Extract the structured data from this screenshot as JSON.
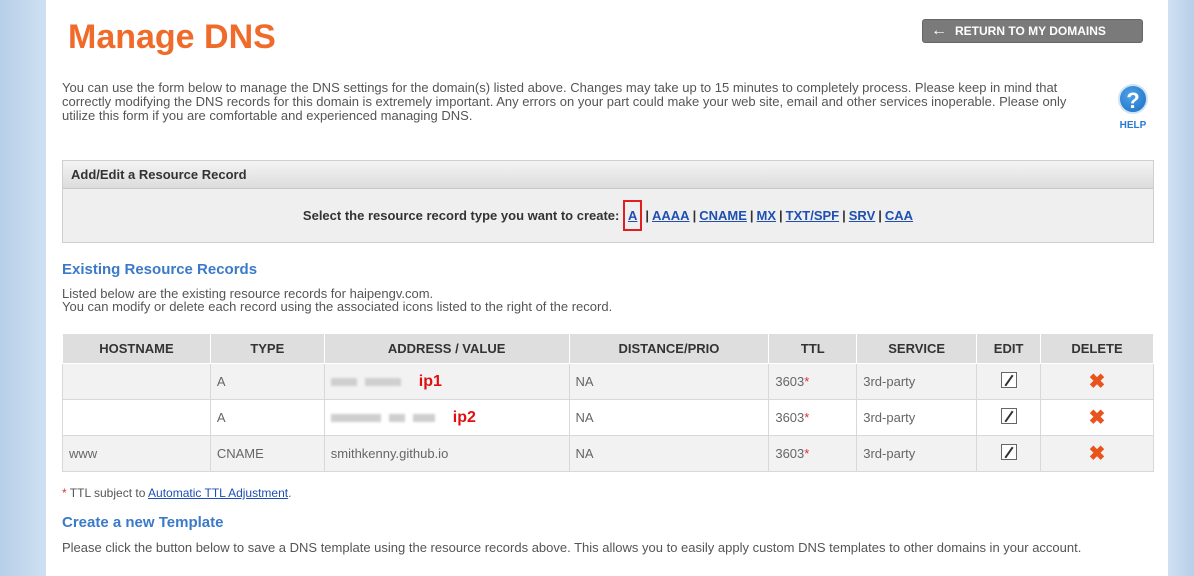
{
  "page": {
    "title": "Manage DNS",
    "return_label": "RETURN TO MY DOMAINS",
    "return_icon": "arrow-left-icon",
    "intro": "You can use the form below to manage the DNS settings for the domain(s) listed above. Changes may take up to 15 minutes to completely process. Please keep in mind that correctly modifying the DNS records for this domain is extremely important. Any errors on your part could make your web site, email and other services inoperable. Please only utilize this form if you are comfortable and experienced managing DNS.",
    "help_label": "HELP",
    "help_glyph": "?"
  },
  "add_record": {
    "header": "Add/Edit a Resource Record",
    "prompt": "Select the resource record type you want to create:",
    "types": [
      "A",
      "AAAA",
      "CNAME",
      "MX",
      "TXT/SPF",
      "SRV",
      "CAA"
    ],
    "highlight_color": "#e02020"
  },
  "existing": {
    "title": "Existing Resource Records",
    "desc_line1": "Listed below are the existing resource records for haipengv.com.",
    "desc_line2": "You can modify or delete each record using the associated icons listed to the right of the record.",
    "columns": [
      "HOSTNAME",
      "TYPE",
      "ADDRESS / VALUE",
      "DISTANCE/PRIO",
      "TTL",
      "SERVICE",
      "EDIT",
      "DELETE"
    ],
    "rows": [
      {
        "hostname": "",
        "type": "A",
        "address": "",
        "annotation": "ip1",
        "prio": "NA",
        "ttl": "3603",
        "service": "3rd-party"
      },
      {
        "hostname": "",
        "type": "A",
        "address": "",
        "annotation": "ip2",
        "prio": "NA",
        "ttl": "3603",
        "service": "3rd-party"
      },
      {
        "hostname": "www",
        "type": "CNAME",
        "address": "smithkenny.github.io",
        "annotation": "",
        "prio": "NA",
        "ttl": "3603",
        "service": "3rd-party"
      }
    ],
    "ttl_star": "*",
    "edit_icon": "edit-pencil-icon",
    "delete_icon": "delete-x-icon",
    "delete_color": "#e8541c"
  },
  "footnote": {
    "star": "*",
    "text": " TTL subject to ",
    "link": "Automatic TTL Adjustment",
    "period": "."
  },
  "template": {
    "title": "Create a new Template",
    "desc": "Please click the button below to save a DNS template using the resource records above. This allows you to easily apply custom DNS templates to other domains in your account."
  },
  "colors": {
    "title_orange": "#f06a2a",
    "link_blue": "#1f4fb0",
    "section_blue": "#3b7ac9",
    "annotation_red": "#e01010"
  }
}
